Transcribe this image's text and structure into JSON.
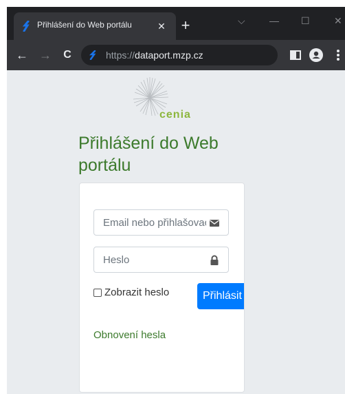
{
  "browser": {
    "tab_title": "Přihlášení do Web portálu",
    "tab_close_symbol": "✕",
    "new_tab_symbol": "+",
    "url_prefix": "https://",
    "url_host": "dataport.mzp.cz",
    "window_controls": {
      "down": "⌵",
      "minimize": "—",
      "maximize": "☐",
      "close": "✕"
    },
    "nav": {
      "back": "←",
      "forward": "→",
      "reload": "C"
    }
  },
  "page": {
    "logo_text": "cenia",
    "title": "Přihlášení do Web portálu",
    "form": {
      "email_placeholder": "Email nebo přihlašovací jméno",
      "password_placeholder": "Heslo",
      "show_password_label": "Zobrazit heslo",
      "login_button": "Přihlásit",
      "reset_link": "Obnovení hesla"
    }
  },
  "colors": {
    "brand_green": "#3c7a2c",
    "logo_green": "#8cb63c",
    "primary_button": "#007bff",
    "page_background": "#e9ecef"
  },
  "icons": {
    "email": "envelope-icon",
    "password": "lock-icon",
    "favicon": "dataport-favicon"
  }
}
